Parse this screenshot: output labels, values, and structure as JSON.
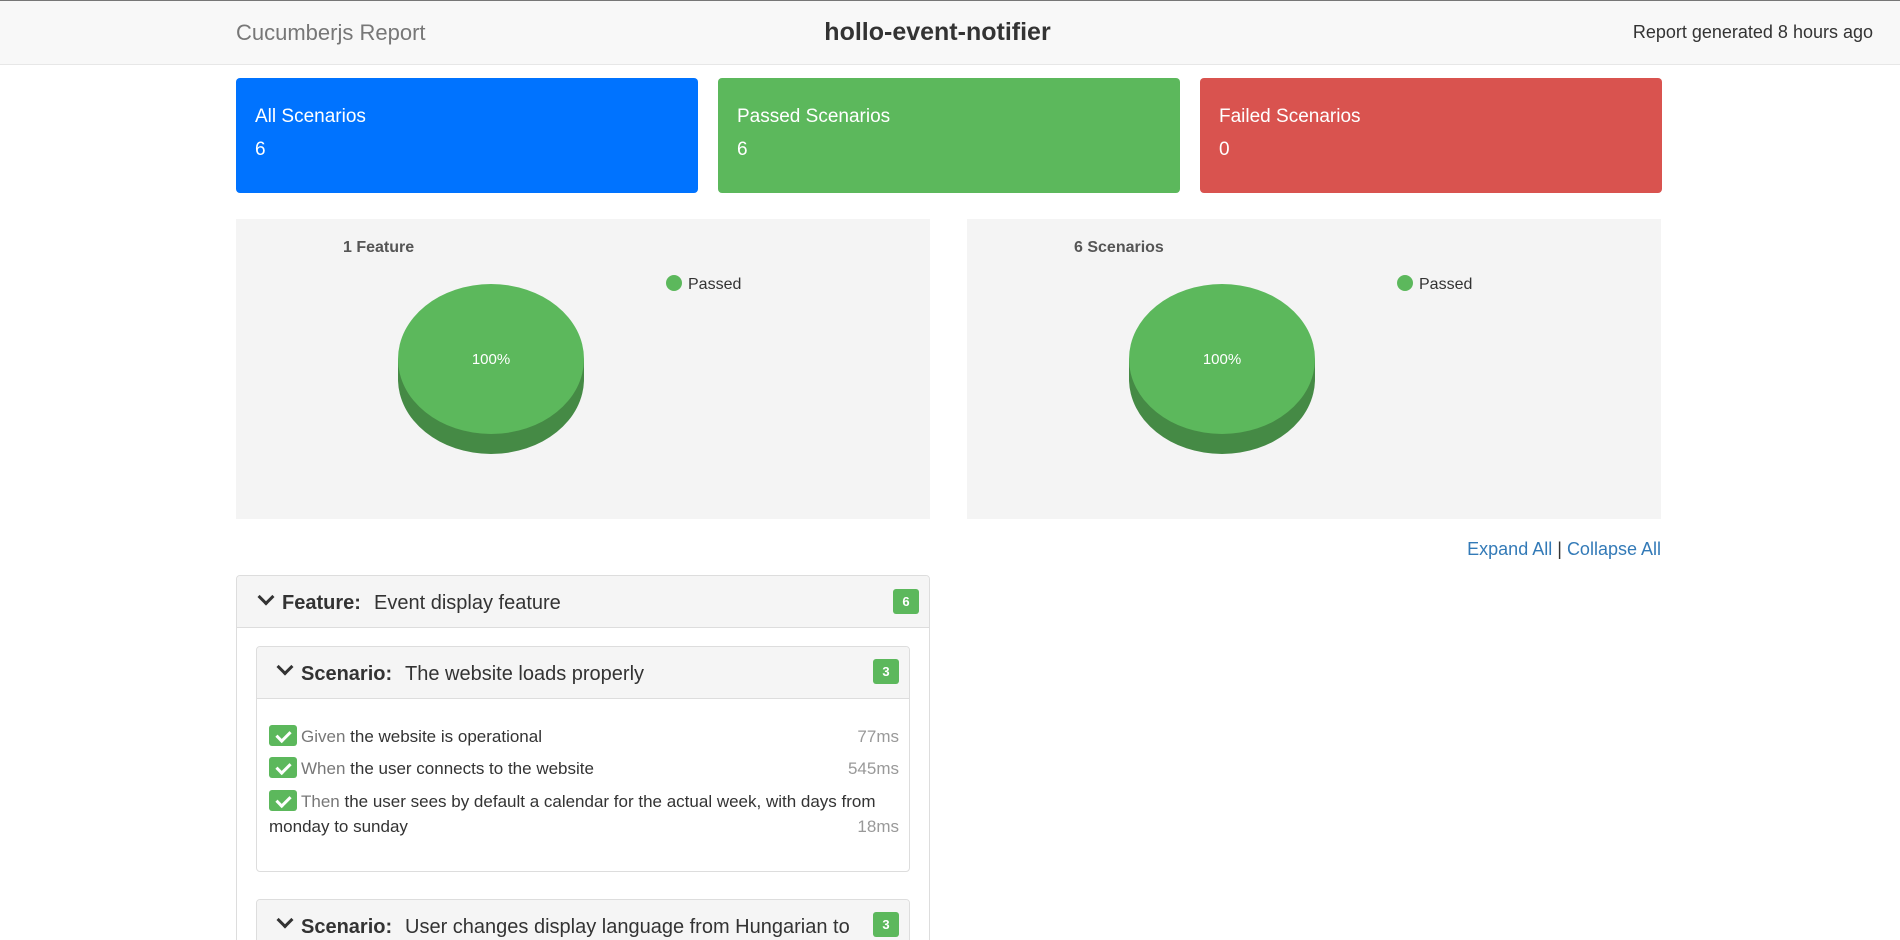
{
  "header": {
    "brand": "Cucumberjs Report",
    "project": "hollo-event-notifier",
    "generated": "Report generated 8 hours ago"
  },
  "tiles": [
    {
      "label": "All Scenarios",
      "value": "6",
      "color": "#0073ff"
    },
    {
      "label": "Passed Scenarios",
      "value": "6",
      "color": "#5cb85c"
    },
    {
      "label": "Failed Scenarios",
      "value": "0",
      "color": "#d9534f"
    }
  ],
  "chart_data": [
    {
      "type": "pie",
      "title": "1 Feature",
      "legend": "top-right",
      "slices": [
        {
          "name": "Passed",
          "value": 100,
          "label": "100%",
          "color": "#5cb85c"
        }
      ]
    },
    {
      "type": "pie",
      "title": "6 Scenarios",
      "legend": "top-right",
      "slices": [
        {
          "name": "Passed",
          "value": 100,
          "label": "100%",
          "color": "#5cb85c"
        }
      ]
    }
  ],
  "controls": {
    "expand_all": "Expand All",
    "separator": "|",
    "collapse_all": "Collapse All"
  },
  "feature": {
    "keyword": "Feature:",
    "name": "Event display feature",
    "count": "6",
    "scenarios": [
      {
        "keyword": "Scenario:",
        "name": "The website loads properly",
        "count": "3",
        "steps": [
          {
            "keyword": "Given",
            "text": " the website is operational",
            "duration": "77ms"
          },
          {
            "keyword": "When",
            "text": " the user connects to the website",
            "duration": "545ms"
          },
          {
            "keyword": "Then",
            "text": " the user sees by default a calendar for the actual week, with days from monday to sunday",
            "duration": "18ms"
          }
        ]
      },
      {
        "keyword": "Scenario:",
        "name": "User changes display language from Hungarian to English",
        "count": "3"
      }
    ]
  }
}
